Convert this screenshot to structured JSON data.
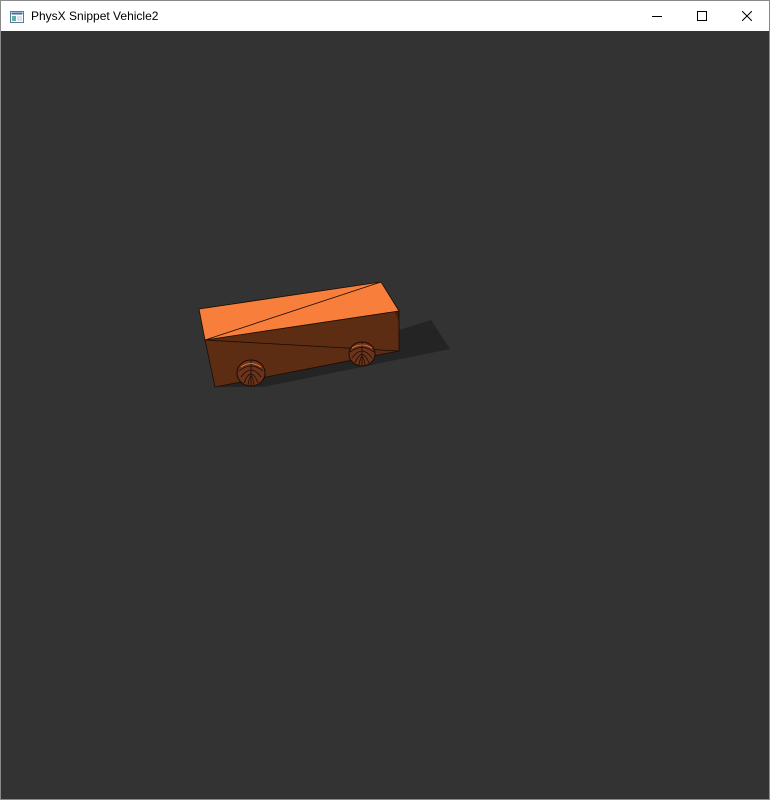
{
  "window": {
    "title": "PhysX Snippet Vehicle2",
    "icons": {
      "app": "app-window-icon",
      "minimize": "minimize-icon",
      "maximize": "maximize-icon",
      "close": "close-icon"
    }
  },
  "scene": {
    "background_color": "#333333",
    "objects": [
      {
        "name": "vehicle-chassis",
        "top_color": "#f77f3b",
        "side_color": "#5c2c13"
      },
      {
        "name": "vehicle-wheel",
        "color": "#6b331b"
      }
    ]
  }
}
